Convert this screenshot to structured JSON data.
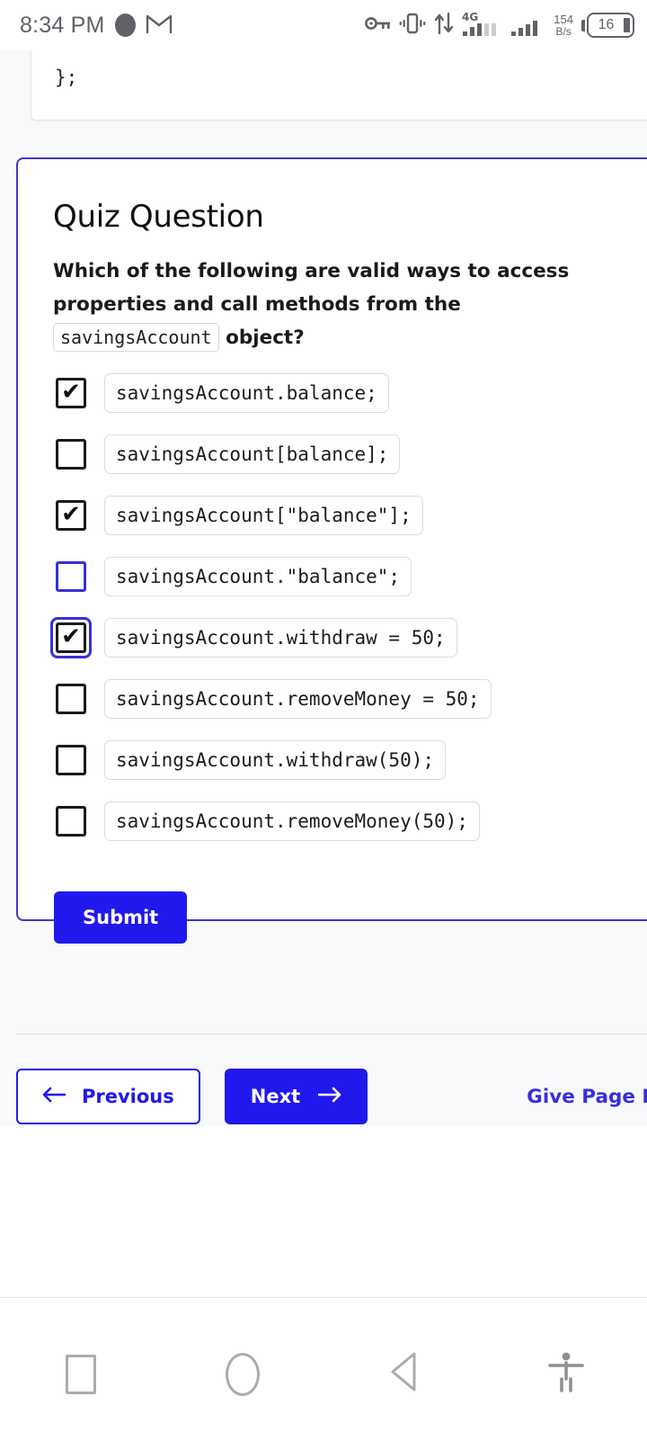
{
  "status_bar": {
    "time": "8:34 PM",
    "icons_left": [
      "record-dot-icon",
      "gmail-icon"
    ],
    "icons_right": [
      "vpn-key-icon",
      "vibrate-icon",
      "data-transfer-icon",
      "signal-4g-icon",
      "signal-bars-icon"
    ],
    "network_type": "4G",
    "net_speed_value": "154",
    "net_speed_unit": "B/s",
    "battery_level": "16"
  },
  "code_block": {
    "last_line": "};"
  },
  "quiz": {
    "title": "Quiz Question",
    "prompt_part1": "Which of the following are valid ways to access properties and call methods from the",
    "prompt_code": "savingsAccount",
    "prompt_part2": "object?",
    "options": [
      {
        "code": "savingsAccount.balance;",
        "checked": true,
        "hovered": false,
        "focused": false
      },
      {
        "code": "savingsAccount[balance];",
        "checked": false,
        "hovered": false,
        "focused": false
      },
      {
        "code": "savingsAccount[\"balance\"];",
        "checked": true,
        "hovered": false,
        "focused": false
      },
      {
        "code": "savingsAccount.\"balance\";",
        "checked": false,
        "hovered": true,
        "focused": false
      },
      {
        "code": "savingsAccount.withdraw = 50;",
        "checked": true,
        "hovered": false,
        "focused": true
      },
      {
        "code": "savingsAccount.removeMoney = 50;",
        "checked": false,
        "hovered": false,
        "focused": false
      },
      {
        "code": "savingsAccount.withdraw(50);",
        "checked": false,
        "hovered": false,
        "focused": false
      },
      {
        "code": "savingsAccount.removeMoney(50);",
        "checked": false,
        "hovered": false,
        "focused": false
      }
    ],
    "submit_label": "Submit",
    "check_glyph": "✔"
  },
  "page_nav": {
    "previous_label": "Previous",
    "previous_icon": "arrow-left-icon",
    "next_label": "Next",
    "next_icon": "arrow-right-icon",
    "feedback_label": "Give Page Feedback"
  },
  "system_nav": {
    "recents": "recents-square-icon",
    "home": "home-circle-icon",
    "back": "back-triangle-icon",
    "accessibility": "accessibility-person-icon"
  },
  "colors": {
    "accent_blue": "#2118ee",
    "card_border": "#4338ca",
    "link_blue": "#3730d8",
    "page_bg": "#f8f9fa"
  }
}
